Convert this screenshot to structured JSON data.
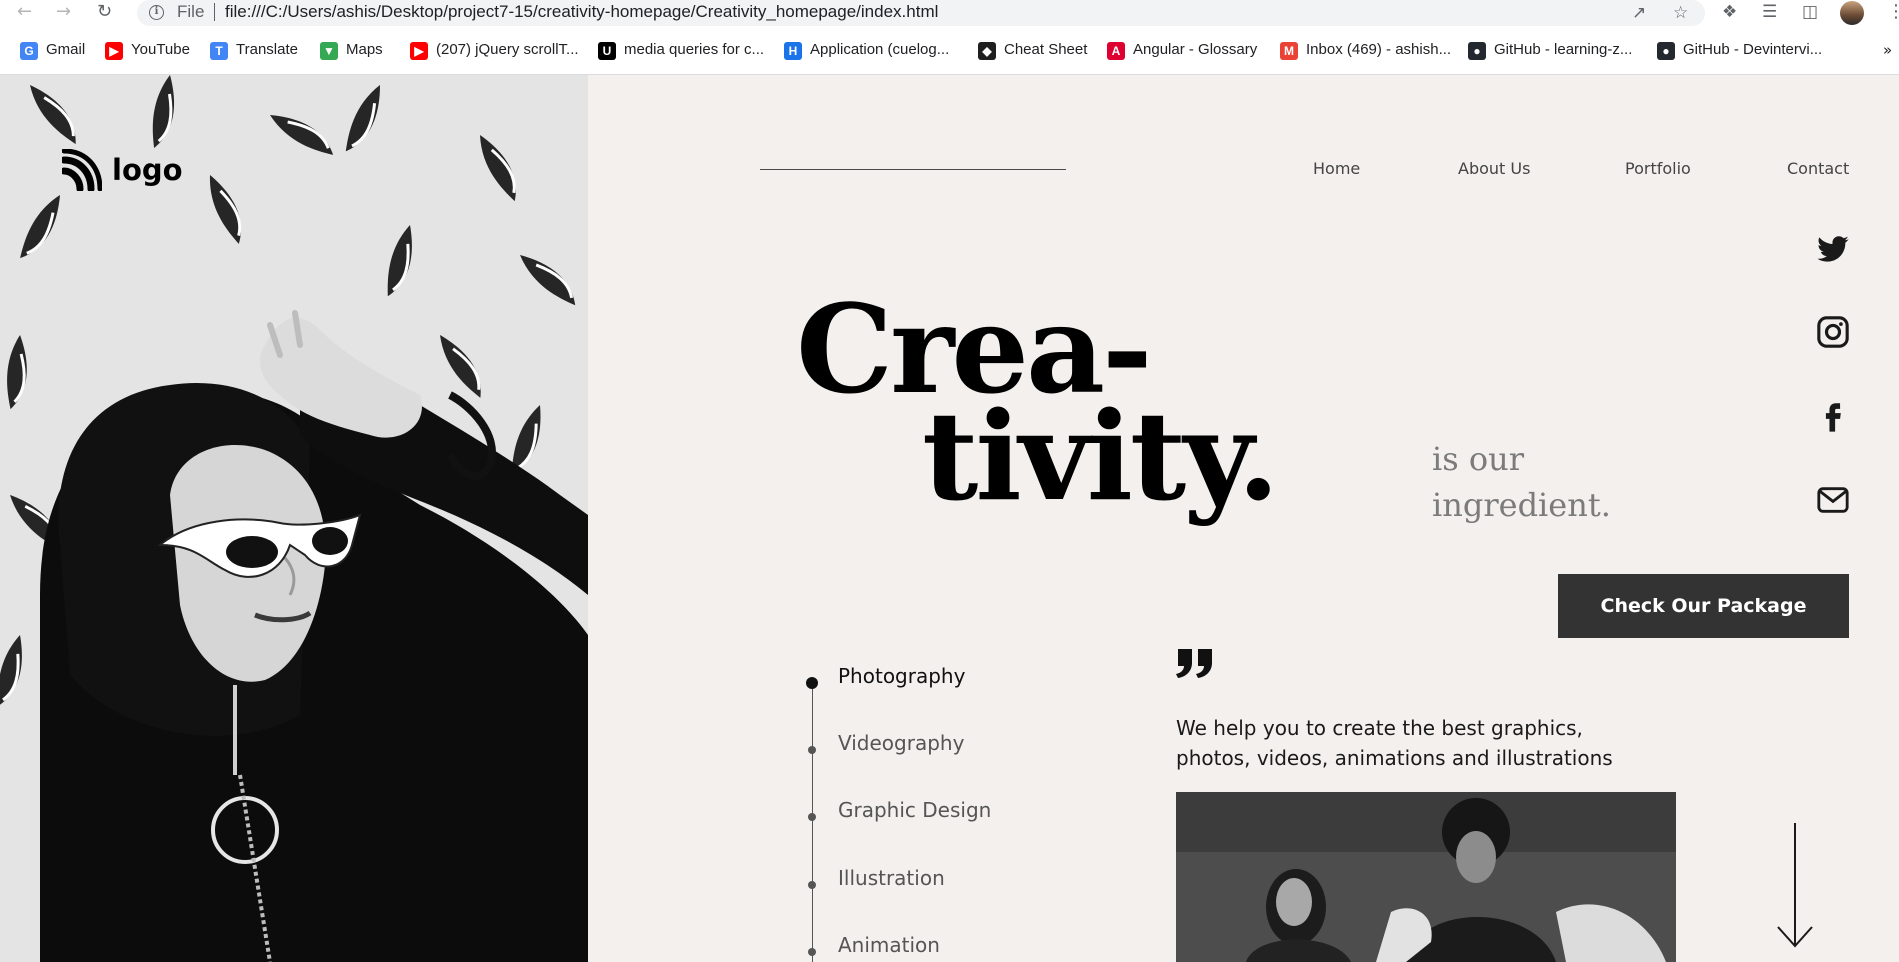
{
  "browser": {
    "url_scheme": "File",
    "url": "file:///C:/Users/ashis/Desktop/project7-15/creativity-homepage/Creativity_homepage/index.html",
    "bookmarks": [
      {
        "label": "Gmail",
        "icon": "google-icon",
        "color": "#4285f4"
      },
      {
        "label": "YouTube",
        "icon": "youtube-icon",
        "color": "#ff0000"
      },
      {
        "label": "Translate",
        "icon": "translate-icon",
        "color": "#4285f4"
      },
      {
        "label": "Maps",
        "icon": "maps-pin-icon",
        "color": "#34a853"
      },
      {
        "label": "(207) jQuery scrollT...",
        "icon": "youtube-icon",
        "color": "#ff0000"
      },
      {
        "label": "media queries for c...",
        "icon": "udacity-icon",
        "color": "#000000"
      },
      {
        "label": "Application (cuelog...",
        "icon": "app-icon",
        "color": "#1a73e8"
      },
      {
        "label": "Cheat Sheet",
        "icon": "cheatsheet-icon",
        "color": "#1f1f1f"
      },
      {
        "label": "Angular - Glossary",
        "icon": "angular-icon",
        "color": "#dd0031"
      },
      {
        "label": "Inbox (469) - ashish...",
        "icon": "gmail-icon",
        "color": "#ea4335"
      },
      {
        "label": "GitHub - learning-z...",
        "icon": "github-icon",
        "color": "#24292f"
      },
      {
        "label": "GitHub - Devintervi...",
        "icon": "github-icon",
        "color": "#24292f"
      }
    ],
    "more_bookmarks": "»"
  },
  "site": {
    "logo_text": "logo",
    "nav": [
      "Home",
      "About Us",
      "Portfolio",
      "Contact"
    ],
    "headline_line1": "Crea-",
    "headline_line2": "tivity.",
    "tagline_line1": "is our",
    "tagline_line2": "ingredient.",
    "cta_label": "Check Our Package",
    "services": [
      {
        "label": "Photography",
        "active": true
      },
      {
        "label": "Videography",
        "active": false
      },
      {
        "label": "Graphic Design",
        "active": false
      },
      {
        "label": "Illustration",
        "active": false
      },
      {
        "label": "Animation",
        "active": false
      }
    ],
    "quote_text": "We help you to create the best graphics, photos, videos, animations and illustrations",
    "social": [
      "twitter-icon",
      "instagram-icon",
      "facebook-icon",
      "mail-icon"
    ],
    "colors": {
      "background": "#f3f0ed",
      "cta_background": "#333333",
      "tagline": "#7b7b7b",
      "headline": "#000000"
    }
  }
}
